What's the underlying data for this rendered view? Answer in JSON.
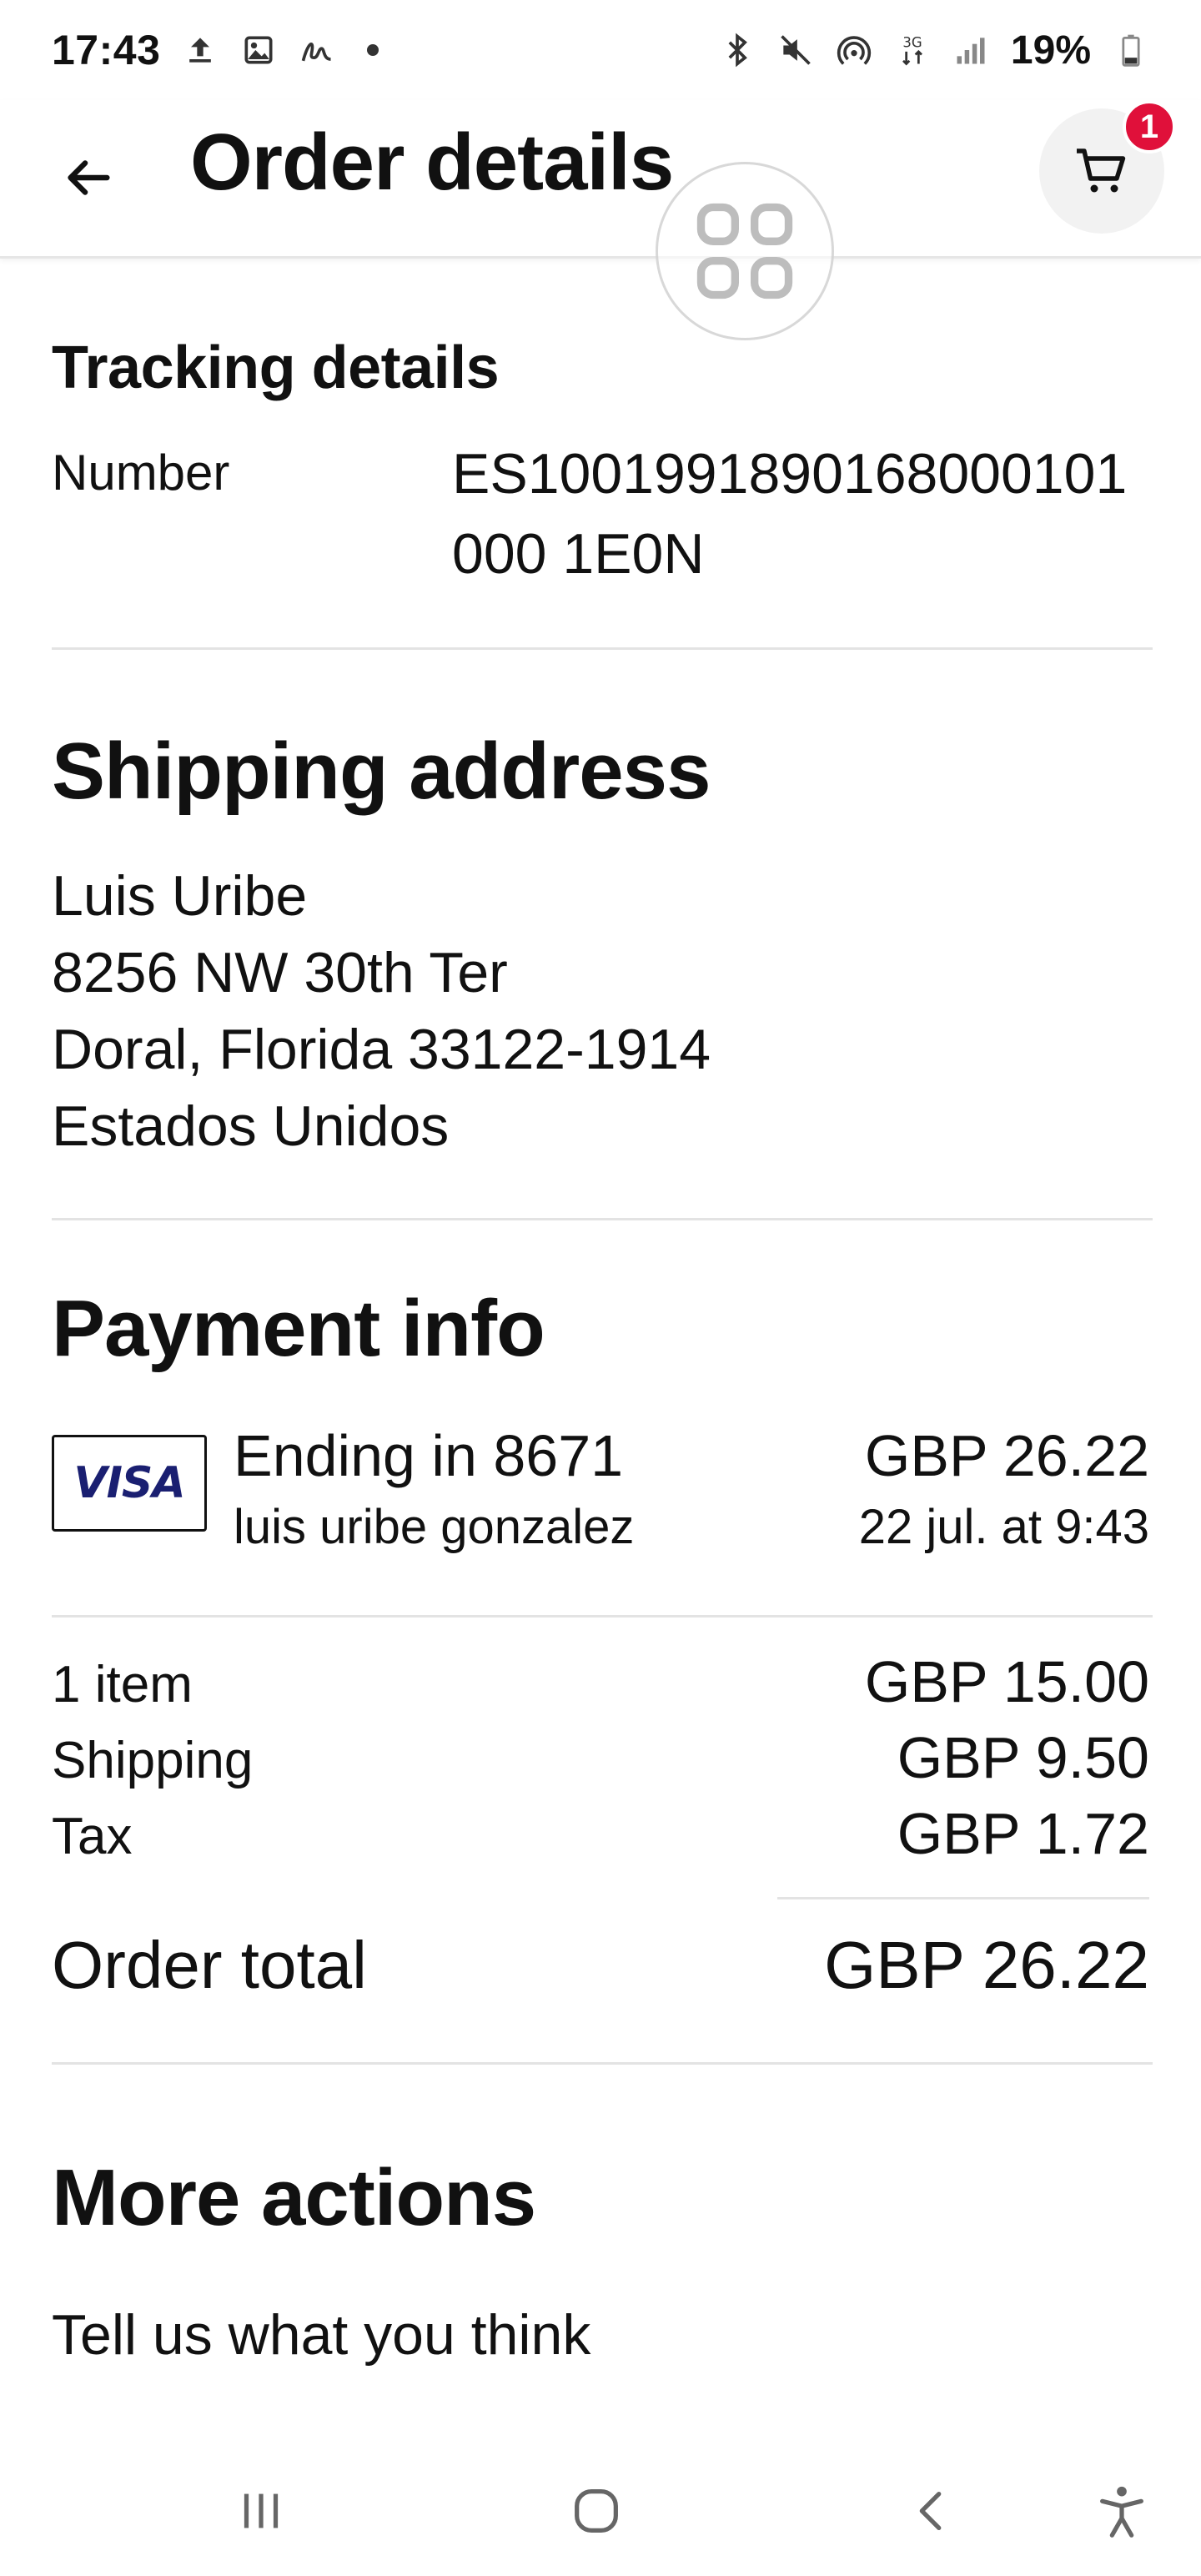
{
  "status_bar": {
    "time": "17:43",
    "left_icons": [
      "upload-icon",
      "image-icon",
      "signature-icon",
      "dot"
    ],
    "right_icons": [
      "bluetooth-icon",
      "mute-icon",
      "hotspot-icon",
      "data-3g-icon",
      "signal-icon",
      "battery-icon"
    ],
    "battery": "19%"
  },
  "header": {
    "title": "Order details",
    "back_icon": "arrow-left-icon",
    "cart_icon": "cart-icon",
    "cart_badge": "1"
  },
  "tracking": {
    "title": "Tracking details",
    "number_label": "Number",
    "number_value": "ES1001991890168000101000 1E0N"
  },
  "shipping": {
    "title": "Shipping address",
    "name": "Luis Uribe",
    "street": "8256 NW 30th Ter",
    "city_line": "Doral, Florida 33122-1914",
    "country": "Estados Unidos"
  },
  "payment": {
    "title": "Payment info",
    "card_brand": "VISA",
    "card_ending": "Ending in 8671",
    "card_holder": "luis uribe gonzalez",
    "amount": "GBP 26.22",
    "date": "22 jul. at 9:43"
  },
  "summary": {
    "rows": [
      {
        "label": "1 item",
        "value": "GBP 15.00"
      },
      {
        "label": "Shipping",
        "value": "GBP 9.50"
      },
      {
        "label": "Tax",
        "value": "GBP 1.72"
      }
    ],
    "total_label": "Order total",
    "total_value": "GBP 26.22"
  },
  "more_actions": {
    "title": "More actions",
    "feedback": "Tell us what you think"
  },
  "nav": {
    "icons": [
      "recent-apps-icon",
      "home-icon",
      "back-icon",
      "accessibility-icon"
    ]
  },
  "colors": {
    "badge": "#e0103a",
    "visa": "#1a1f71",
    "divider": "#e3e3e3"
  }
}
